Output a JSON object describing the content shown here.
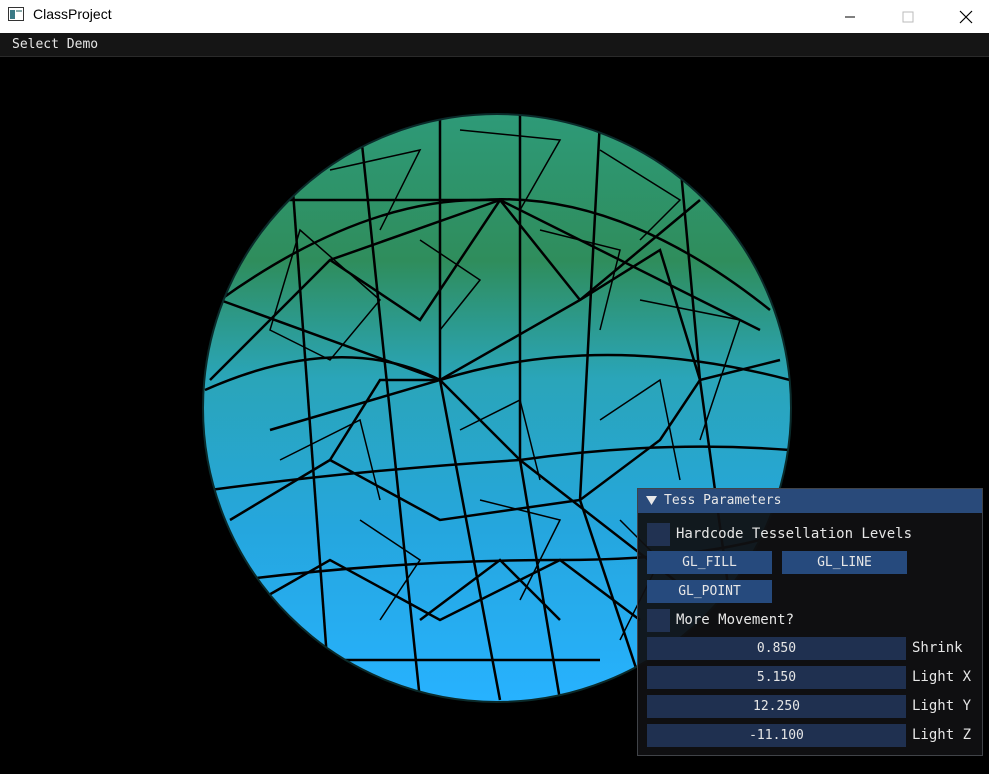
{
  "window": {
    "title": "ClassProject"
  },
  "menubar": {
    "items": [
      "Select Demo"
    ]
  },
  "panel": {
    "title": "Tess Parameters",
    "hardcode_label": "Hardcode Tessellation Levels",
    "buttons": {
      "fill": "GL_FILL",
      "line": "GL_LINE",
      "point": "GL_POINT"
    },
    "movement_label": "More Movement?",
    "sliders": [
      {
        "value": "0.850",
        "label": "Shrink"
      },
      {
        "value": "5.150",
        "label": "Light X"
      },
      {
        "value": "12.250",
        "label": "Light Y"
      },
      {
        "value": "-11.100",
        "label": "Light Z"
      }
    ]
  },
  "scene": {
    "object": "tessellated sphere",
    "colors": {
      "top": "#2f8a5a",
      "middle": "#2aa7c7",
      "bottom": "#27b0ff"
    }
  }
}
